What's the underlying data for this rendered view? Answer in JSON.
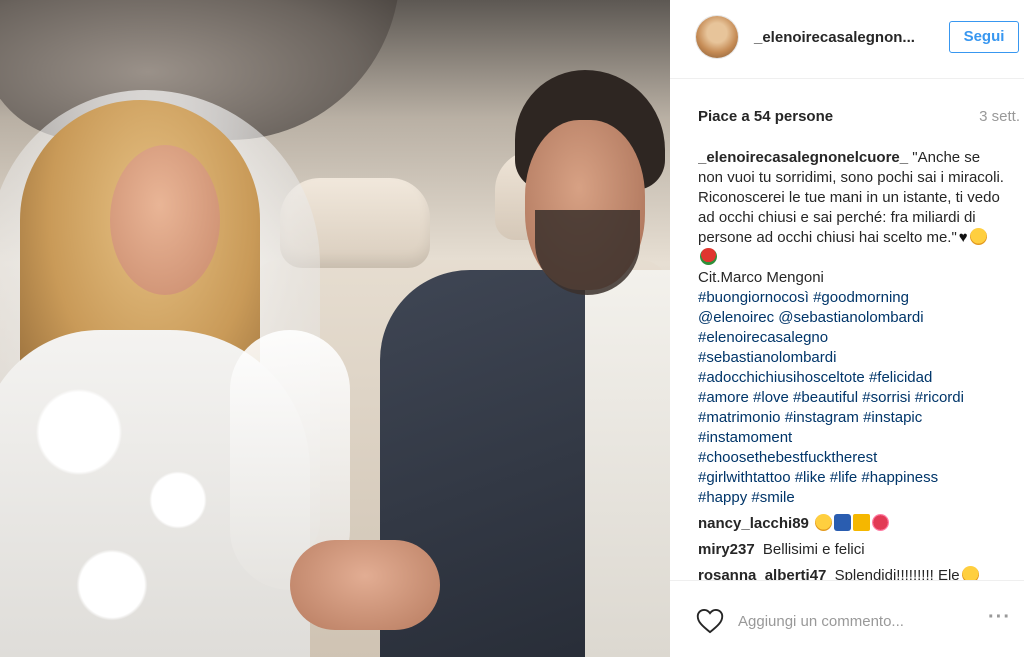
{
  "post": {
    "username": "_elenoirecasalegnon...",
    "follow_label": "Segui",
    "likes": "Piace a 54 persone",
    "time": "3 sett."
  },
  "caption": {
    "author": "_elenoirecasalegnonelcuore_",
    "text": "\"Anche se non vuoi tu sorridimi, sono pochi sai i miracoli. Riconoscerei le tue mani in un istante, ti vedo ad occhi chiusi e sai perché: fra miliardi di persone ad occhi chiusi hai scelto me.\"",
    "citation": "Cit.Marco Mengoni",
    "hashtag_lines": [
      "#buongiornocosì #goodmorning",
      "@elenoirec @sebastianolombardi",
      "#elenoirecasalegno",
      "#sebastianolombardi",
      "#adocchichiusihosceltote #felicidad",
      "#amore #love #beautiful #sorrisi #ricordi",
      "#matrimonio #instagram #instapic",
      "#instamoment",
      "#choosethebestfucktherest",
      "#girlwithtattoo #like #life #happiness",
      "#happy #smile"
    ]
  },
  "comments": [
    {
      "author": "nancy_lacchi89",
      "text": ""
    },
    {
      "author": "miry237",
      "text": "Bellisimi e felici"
    },
    {
      "author": "rosanna_alberti47",
      "text": "Splendidi!!!!!!!!! Ele"
    }
  ],
  "input": {
    "placeholder": "Aggiungi un commento..."
  },
  "icons": [
    "heart-icon",
    "more-options-icon",
    "heart-emoji",
    "smiling-face-heart-eyes-emoji",
    "rose-emoji",
    "top-emoji",
    "crown-emoji",
    "two-hearts-emoji"
  ],
  "colors": {
    "link": "#003569",
    "follow": "#3897f0",
    "muted": "#999999",
    "text": "#262626"
  }
}
